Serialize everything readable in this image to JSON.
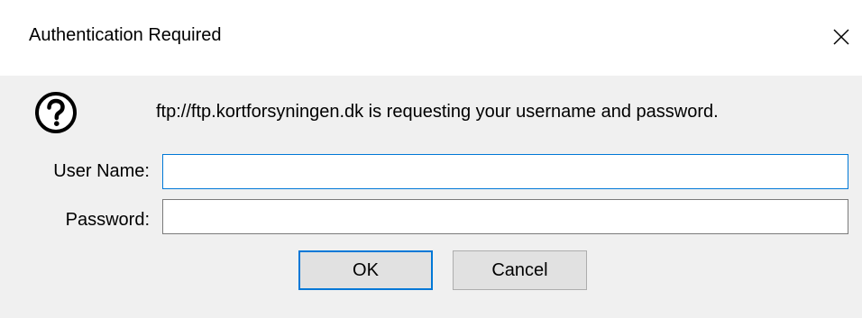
{
  "dialog": {
    "title": "Authentication Required",
    "close_icon": "close-icon",
    "message_icon": "question-icon",
    "message": "ftp://ftp.kortforsyningen.dk is requesting your username and password.",
    "username": {
      "label": "User Name:",
      "value": ""
    },
    "password": {
      "label": "Password:",
      "value": ""
    },
    "buttons": {
      "ok": "OK",
      "cancel": "Cancel"
    },
    "colors": {
      "focus_accent": "#0078d7",
      "button_bg": "#e1e1e1",
      "dialog_bg": "#f0f0f0",
      "titlebar_bg": "#ffffff"
    }
  }
}
